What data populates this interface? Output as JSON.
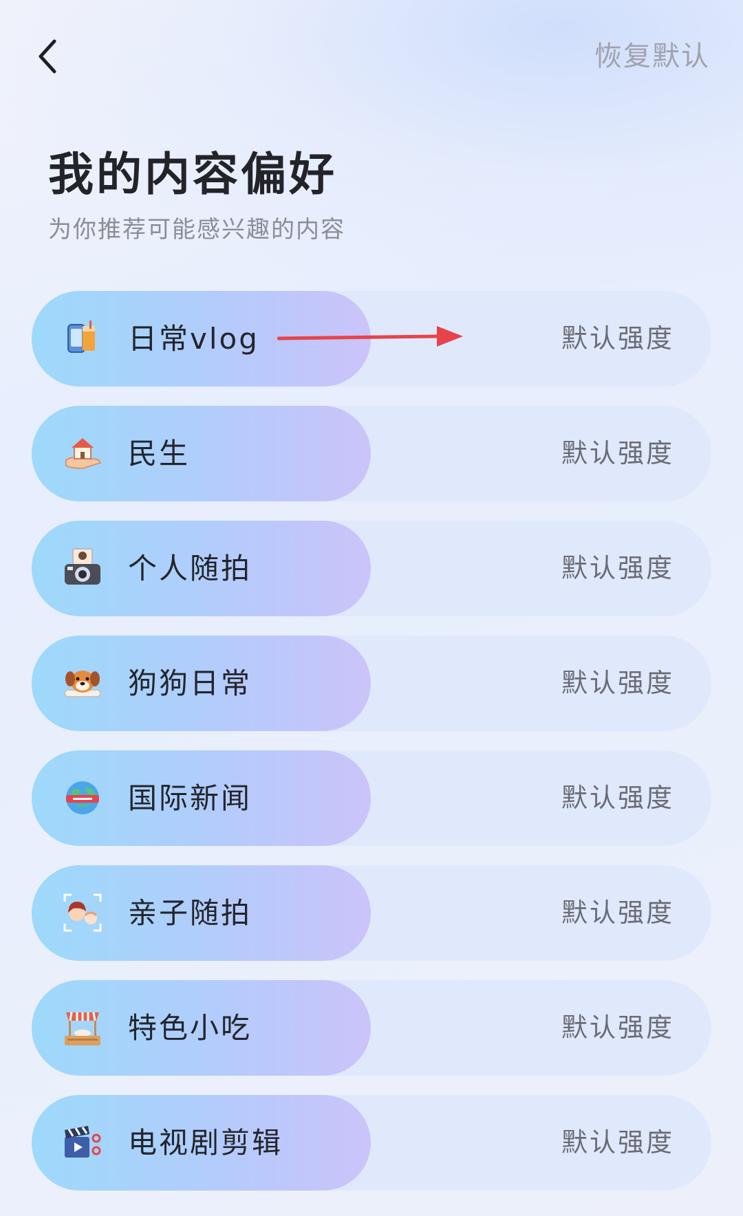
{
  "header": {
    "back_icon": "chevron-left-icon",
    "reset_label": "恢复默认"
  },
  "page": {
    "title": "我的内容偏好",
    "subtitle": "为你推荐可能感兴趣的内容"
  },
  "categories": [
    {
      "label": "日常vlog",
      "icon": "phone-drink-icon",
      "strength": "默认强度"
    },
    {
      "label": "民生",
      "icon": "house-in-hand-icon",
      "strength": "默认强度"
    },
    {
      "label": "个人随拍",
      "icon": "camera-icon",
      "strength": "默认强度"
    },
    {
      "label": "狗狗日常",
      "icon": "dog-icon",
      "strength": "默认强度"
    },
    {
      "label": "国际新闻",
      "icon": "globe-news-icon",
      "strength": "默认强度"
    },
    {
      "label": "亲子随拍",
      "icon": "parent-child-icon",
      "strength": "默认强度"
    },
    {
      "label": "特色小吃",
      "icon": "food-stall-icon",
      "strength": "默认强度"
    },
    {
      "label": "电视剧剪辑",
      "icon": "clapperboard-icon",
      "strength": "默认强度"
    }
  ],
  "annotation": {
    "arrow_color": "#e8434b"
  },
  "colors": {
    "pill_start": "#9dd9fb",
    "pill_end": "#cbc4f9",
    "track": "#dfe8fc",
    "title": "#23242a",
    "subtitle": "#8b8d96",
    "reset": "#a0a2ac"
  }
}
